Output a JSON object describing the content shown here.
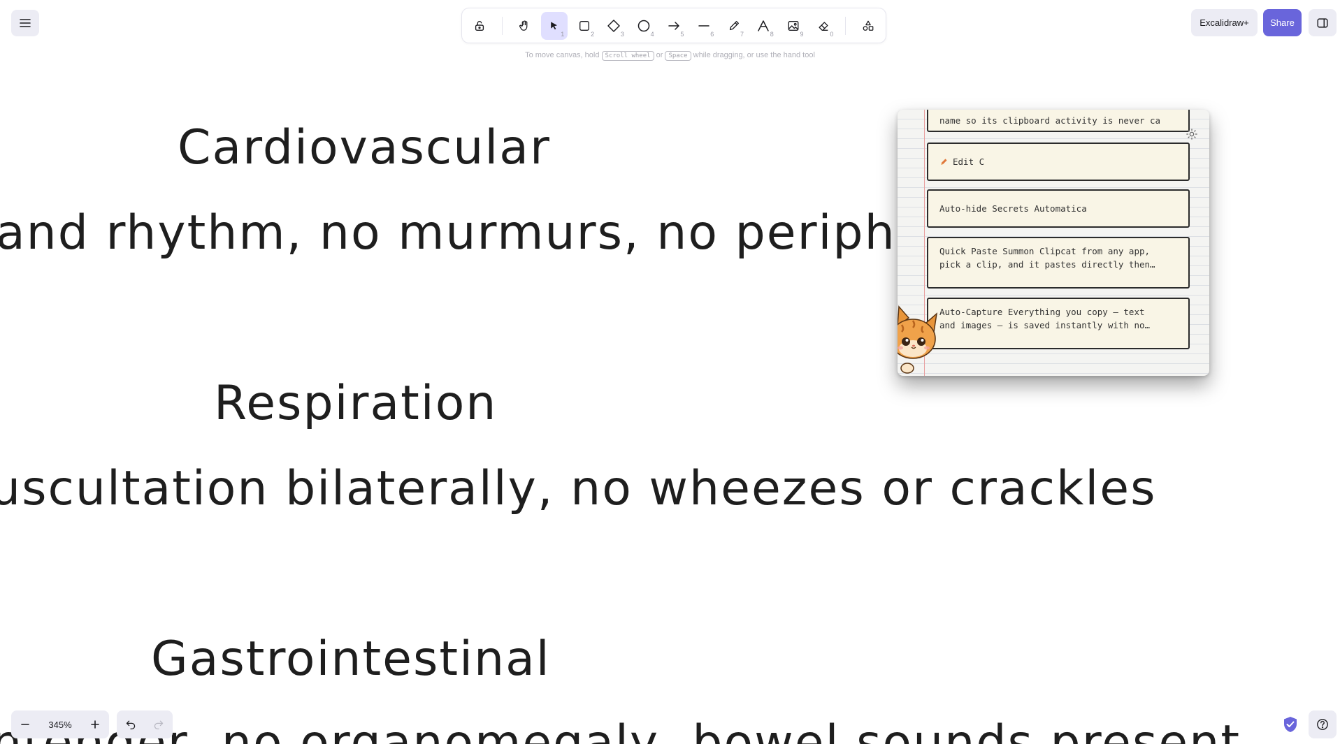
{
  "canvas": {
    "headings": [
      "Cardiovascular",
      "Respiration",
      "Gastrointestinal"
    ],
    "lines": [
      "and rhythm, no murmurs, no peripheral e",
      "uscultation bilaterally, no wheezes or crackles",
      "ntender, no organomegaly, bowel sounds present"
    ]
  },
  "toolbar": {
    "tools": [
      {
        "name": "lock",
        "key": ""
      },
      {
        "name": "hand",
        "key": ""
      },
      {
        "name": "selection",
        "key": "1"
      },
      {
        "name": "rectangle",
        "key": "2"
      },
      {
        "name": "diamond",
        "key": "3"
      },
      {
        "name": "ellipse",
        "key": "4"
      },
      {
        "name": "arrow",
        "key": "5"
      },
      {
        "name": "line",
        "key": "6"
      },
      {
        "name": "draw",
        "key": "7"
      },
      {
        "name": "text",
        "key": "8"
      },
      {
        "name": "image",
        "key": "9"
      },
      {
        "name": "eraser",
        "key": "0"
      },
      {
        "name": "extra-tools",
        "key": ""
      }
    ],
    "active_tool": "selection"
  },
  "hint": {
    "part1": "To move canvas, hold",
    "key1": "Scroll wheel",
    "part2": "or",
    "key2": "Space",
    "part3": "while dragging, or use the hand tool"
  },
  "header": {
    "plus_label": "Excalidraw+",
    "share_label": "Share"
  },
  "footer": {
    "zoom": "345%"
  },
  "clipcat": {
    "cards": [
      {
        "line1": "name so its clipboard activity is never ca",
        "line2": ""
      },
      {
        "line1": "Edit C",
        "line2": ""
      },
      {
        "line1": "Auto-hide Secrets Automatica",
        "line2": ""
      },
      {
        "line1": "Quick Paste Summon Clipcat from any app,",
        "line2": "pick a clip, and it pastes directly then…"
      },
      {
        "line1": "Auto-Capture Everything you copy — text",
        "line2": "and images — is saved instantly with no…"
      }
    ]
  },
  "colors": {
    "accent": "#6965db",
    "active_tool_bg": "#e0dfff",
    "island_bg": "#ececf4",
    "card_bg": "#f9f5e6"
  }
}
